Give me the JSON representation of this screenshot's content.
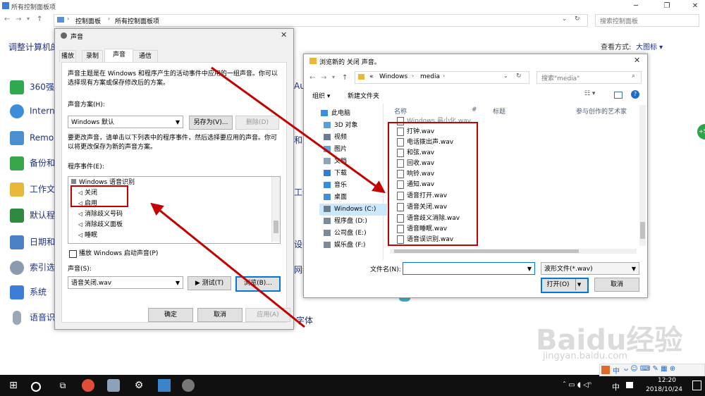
{
  "control_panel": {
    "window_title": "所有控制面板项",
    "breadcrumb": [
      "控制面板",
      "所有控制面板项"
    ],
    "search_placeholder": "搜索控制面板",
    "left_title": "调整计算机的",
    "view_label": "查看方式:",
    "view_value": "大图标",
    "items": [
      "360强",
      "Intern",
      "Remo",
      "备份和",
      "工作文",
      "默认程",
      "日期和",
      "索引选",
      "系统",
      "语音识"
    ],
    "right_fragments": [
      "Auto",
      "和区",
      "工作",
      "设备",
      "网络",
      "字体"
    ]
  },
  "sound_dialog": {
    "title": "声音",
    "tabs": [
      "播放",
      "录制",
      "声音",
      "通信"
    ],
    "description": "声音主题是在 Windows 和程序产生的活动事件中应用的一组声音。你可以选择现有方案或保存修改后的方案。",
    "scheme_label": "声音方案(H):",
    "scheme_value": "Windows 默认",
    "save_as_label": "另存为(V)...",
    "delete_label": "删除(D)",
    "change_desc": "要更改声音，请单击以下列表中的程序事件，然后选择要应用的声音。你可以将更改保存为新的声音方案。",
    "events_label": "程序事件(E):",
    "events_group": "Windows 语音识别",
    "events": [
      "关闭",
      "启用",
      "消除歧义号码",
      "消除歧义面板",
      "睡眠"
    ],
    "startup_checkbox_label": "播放 Windows 启动声音(P)",
    "sounds_label": "声音(S):",
    "sounds_value": "语音关闭.wav",
    "test_label": "▶ 测试(T)",
    "browse_label": "浏览(B)...",
    "ok_label": "确定",
    "cancel_label": "取消",
    "apply_label": "应用(A)"
  },
  "browse_dialog": {
    "title": "浏览新的 关闭 声音。",
    "path": [
      "«",
      "Windows",
      "media"
    ],
    "search_placeholder": "搜索\"media\"",
    "organize_label": "组织 ▾",
    "new_folder_label": "新建文件夹",
    "nav_items": [
      "此电脑",
      "3D 对象",
      "视频",
      "图片",
      "文档",
      "下载",
      "音乐",
      "桌面",
      "Windows (C:)",
      "程序盘 (D:)",
      "公司盘 (E:)",
      "娱乐盘 (F:)"
    ],
    "columns": [
      "名称",
      "#",
      "标题",
      "参与创作的艺术家"
    ],
    "files": [
      "Windows 最小化.wav",
      "打钟.wav",
      "电话拨出声.wav",
      "和弦.wav",
      "回收.wav",
      "响铃.wav",
      "通知.wav",
      "语音打开.wav",
      "语音关闭.wav",
      "语音歧义消除.wav",
      "语音睡眠.wav",
      "语音误识别.wav"
    ],
    "filename_label": "文件名(N):",
    "filename_value": "",
    "filetype_value": "波形文件(*.wav)",
    "open_label": "打开(O)",
    "cancel_label": "取消"
  },
  "taskbar": {
    "time": "12:20",
    "date": "2018/10/24",
    "ime": "中"
  },
  "watermark": {
    "brand": "Baidu经验",
    "url": "jingyan.baidu.com"
  },
  "colors": {
    "link_blue": "#1e3287",
    "annotation_red": "#c40000",
    "taskbar": "#101010"
  }
}
